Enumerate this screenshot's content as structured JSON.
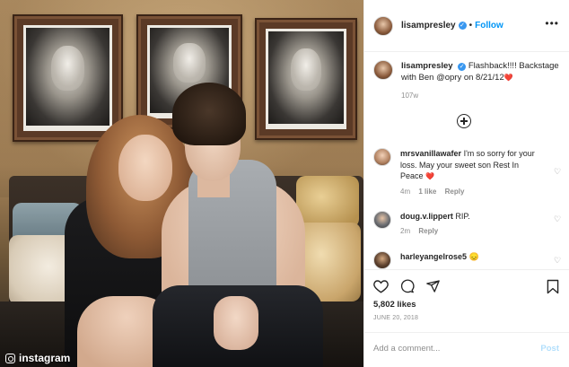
{
  "watermark": {
    "text": "instagram"
  },
  "post": {
    "username": "lisampresley",
    "follow_label": "Follow",
    "separator": "•",
    "more_label": "•••",
    "caption_user": "lisampresley",
    "caption_text": "Flashback!!!! Backstage with Ben @opry on 8/21/12",
    "caption_emoji": "❤️",
    "caption_age": "107w",
    "likes": "5,802 likes",
    "date": "JUNE 20, 2018"
  },
  "comments": [
    {
      "user": "mrsvanillawafer",
      "text": "I'm so sorry for your loss. May your sweet son Rest In Peace",
      "emoji": "❤️",
      "age": "4m",
      "likes": "1 like",
      "reply": "Reply"
    },
    {
      "user": "doug.v.lippert",
      "text": "RIP.",
      "emoji": "",
      "age": "2m",
      "likes": "",
      "reply": "Reply"
    },
    {
      "user": "harleyangelrose5",
      "text": "",
      "emoji": "😞",
      "age": "",
      "likes": "",
      "reply": ""
    }
  ],
  "add_comment": {
    "placeholder": "Add a comment...",
    "post_label": "Post"
  },
  "colors": {
    "accent": "#0095f6",
    "verified": "#3897f0",
    "heart": "#ed4956",
    "muted": "#8e8e8e"
  },
  "icons": [
    "heart-icon",
    "comment-icon",
    "share-icon",
    "bookmark-icon",
    "plus-circle-icon",
    "verified-icon",
    "instagram-icon"
  ]
}
